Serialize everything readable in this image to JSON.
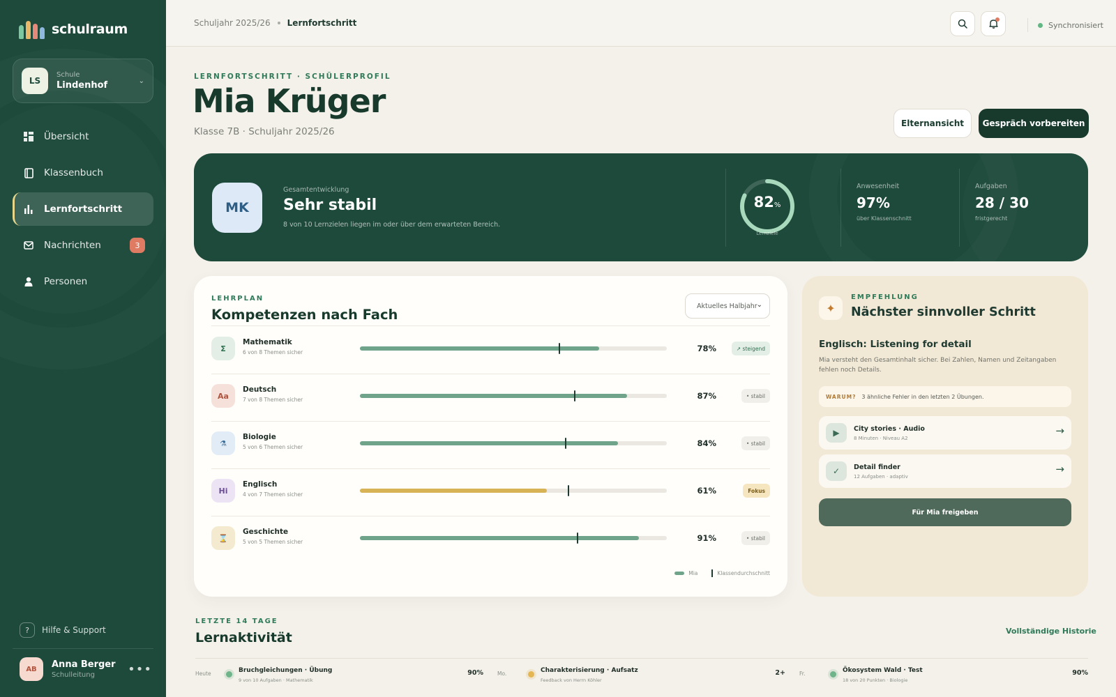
{
  "brand": {
    "name": "schulraum",
    "logo_colors": [
      "#7cc6a0",
      "#e8b86a",
      "#e5897a",
      "#8fb8de"
    ]
  },
  "school": {
    "badge": "LS",
    "label": "Schule",
    "name": "Lindenhof"
  },
  "nav": [
    {
      "label": "Übersicht",
      "icon": "grid-icon",
      "active": false
    },
    {
      "label": "Klassenbuch",
      "icon": "book-icon",
      "active": false
    },
    {
      "label": "Lernfortschritt",
      "icon": "bar-chart-icon",
      "active": true
    },
    {
      "label": "Nachrichten",
      "icon": "mail-icon",
      "active": false,
      "count": "3"
    },
    {
      "label": "Personen",
      "icon": "person-icon",
      "active": false
    }
  ],
  "help": {
    "icon": "?",
    "label": "Hilfe & Support"
  },
  "user": {
    "initials": "AB",
    "name": "Anna Berger",
    "role": "Schulleitung",
    "more": "•••"
  },
  "topbar": {
    "breadcrumb_year": "Schuljahr 2025/26",
    "breadcrumb_current": "Lernfortschritt",
    "sync_label": "Synchronisiert"
  },
  "header": {
    "eyebrow": "LERNFORTSCHRITT · SCHÜLERPROFIL",
    "title": "Mia Krüger",
    "subtitle": "Klasse 7B · Schuljahr 2025/26",
    "btn_parent": "Elternansicht",
    "btn_prepare": "Gespräch vorbereiten"
  },
  "summary": {
    "initials": "MK",
    "label": "Gesamtentwicklung",
    "value": "Sehr stabil",
    "desc": "8 von 10 Lernzielen liegen im oder über dem erwarteten Bereich.",
    "ring_value": "82",
    "ring_unit": "%",
    "ring_fraction": 0.82,
    "ring_label": "Lernziele",
    "attendance_label": "Anwesenheit",
    "attendance_value": "97%",
    "attendance_sub": "über Klassenschnitt",
    "tasks_label": "Aufgaben",
    "tasks_value": "28 / 30",
    "tasks_sub": "fristgerecht"
  },
  "competences": {
    "eyebrow": "LEHRPLAN",
    "title": "Kompetenzen nach Fach",
    "period": "Aktuelles Halbjahr",
    "subjects": [
      {
        "icon": "Σ",
        "icon_name": "sigma-icon",
        "name": "Mathematik",
        "sub": "6 von 8 Themen sicher",
        "value": 78,
        "class_avg": 65,
        "pct": "78%",
        "tag": "↗ steigend",
        "tag_type": "up",
        "bg": "#e3efe6",
        "fg": "#2f6f50",
        "bar": "#6fa48a"
      },
      {
        "icon": "Aa",
        "icon_name": "text-icon",
        "name": "Deutsch",
        "sub": "7 von 8 Themen sicher",
        "value": 87,
        "class_avg": 70,
        "pct": "87%",
        "tag": "• stabil",
        "tag_type": "stable",
        "bg": "#f6e1da",
        "fg": "#b0543f",
        "bar": "#6fa48a"
      },
      {
        "icon": "⚗",
        "icon_name": "flask-icon",
        "name": "Biologie",
        "sub": "5 von 6 Themen sicher",
        "value": 84,
        "class_avg": 67,
        "pct": "84%",
        "tag": "• stabil",
        "tag_type": "stable",
        "bg": "#e1ecf7",
        "fg": "#3b6d96",
        "bar": "#6fa48a"
      },
      {
        "icon": "Hi",
        "icon_name": "language-icon",
        "name": "Englisch",
        "sub": "4 von 7 Themen sicher",
        "value": 61,
        "class_avg": 68,
        "pct": "61%",
        "tag": "Fokus",
        "tag_type": "focus",
        "bg": "#ece4f4",
        "fg": "#6b4e94",
        "bar": "#d8b356"
      },
      {
        "icon": "⌛",
        "icon_name": "hourglass-icon",
        "name": "Geschichte",
        "sub": "5 von 5 Themen sicher",
        "value": 91,
        "class_avg": 71,
        "pct": "91%",
        "tag": "• stabil",
        "tag_type": "stable",
        "bg": "#f4ead0",
        "fg": "#9b7a2f",
        "bar": "#6fa48a"
      }
    ],
    "legend_mia": "Mia",
    "legend_avg": "Klassendurchschnitt"
  },
  "recommendation": {
    "icon": "✦",
    "eyebrow": "EMPFEHLUNG",
    "title": "Nächster sinnvoller Schritt",
    "headline": "Englisch: Listening for detail",
    "desc": "Mia versteht den Gesamtinhalt sicher. Bei Zahlen, Namen und Zeitangaben fehlen noch Details.",
    "why_label": "WARUM?",
    "why_text": "3 ähnliche Fehler in den letzten 2 Übungen.",
    "resources": [
      {
        "icon": "▶",
        "icon_name": "play-icon",
        "title": "City stories · Audio",
        "sub": "8 Minuten · Niveau A2"
      },
      {
        "icon": "✓",
        "icon_name": "check-icon",
        "title": "Detail finder",
        "sub": "12 Aufgaben · adaptiv"
      }
    ],
    "release": "Für Mia freigeben"
  },
  "activity": {
    "eyebrow": "LETZTE 14 TAGE",
    "title": "Lernaktivität",
    "link": "Vollständige Historie",
    "items": [
      {
        "day": "Heute",
        "title": "Bruchgleichungen · Übung",
        "sub": "9 von 10 Aufgaben · Mathematik",
        "value": "90%",
        "dot": "#6fb48a"
      },
      {
        "day": "Mo.",
        "title": "Charakterisierung · Aufsatz",
        "sub": "Feedback von Herrn Köhler",
        "value": "2+",
        "dot": "#e3b553"
      },
      {
        "day": "Fr.",
        "title": "Ökosystem Wald · Test",
        "sub": "18 von 20 Punkten · Biologie",
        "value": "90%",
        "dot": "#6fb48a"
      }
    ]
  }
}
